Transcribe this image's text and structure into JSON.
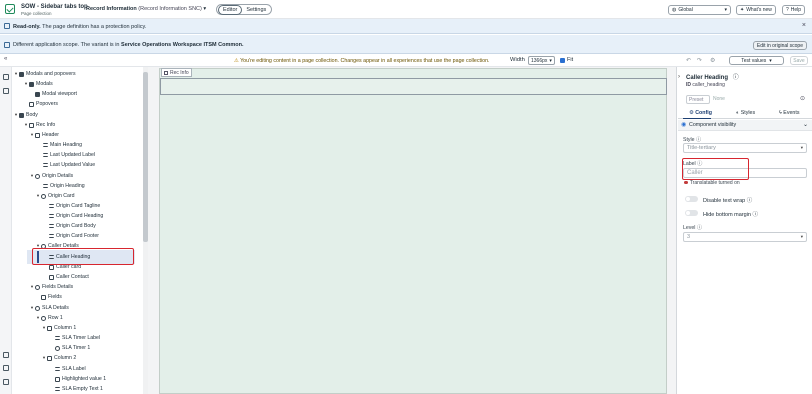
{
  "header": {
    "app_title": "SOW - Sidebar tabs top",
    "app_subtitle": "Page collection",
    "record_title": "Record Information",
    "record_sub": "(Record Information SNC)",
    "mode_editor": "Editor",
    "mode_settings": "Settings",
    "scope": "Global",
    "whats_new": "What's new",
    "help": "Help"
  },
  "banners": {
    "readonly_bold": "Read-only.",
    "readonly_text": "The page definition has a protection policy.",
    "scope_text": "Different application scope. The variant is in",
    "scope_name": "Service Operations Workspace ITSM Common.",
    "edit_scope_button": "Edit in original scope"
  },
  "toolbar": {
    "warning": "You're editing content in a page collection. Changes appear in all experiences that use the page collection.",
    "width_label": "Width",
    "width_value": "1366px",
    "fit_label": "Fit",
    "test_values": "Test values",
    "save": "Save"
  },
  "tree": {
    "items": [
      {
        "label": "Modals and popovers"
      },
      {
        "label": "Modals"
      },
      {
        "label": "Modal viewport"
      },
      {
        "label": "Popovers"
      },
      {
        "label": "Body"
      },
      {
        "label": "Rec Info"
      },
      {
        "label": "Header"
      },
      {
        "label": "Main Heading"
      },
      {
        "label": "Last Updated Label"
      },
      {
        "label": "Last Updated Value"
      },
      {
        "label": "Origin Details"
      },
      {
        "label": "Origin Heading"
      },
      {
        "label": "Origin Card"
      },
      {
        "label": "Origin Card Tagline"
      },
      {
        "label": "Origin Card Heading"
      },
      {
        "label": "Origin Card Body"
      },
      {
        "label": "Origin Card Footer"
      },
      {
        "label": "Caller Details"
      },
      {
        "label": "Caller Heading"
      },
      {
        "label": "Caller card"
      },
      {
        "label": "Caller Contact"
      },
      {
        "label": "Fields Details"
      },
      {
        "label": "Fields"
      },
      {
        "label": "SLA Details"
      },
      {
        "label": "Row 1"
      },
      {
        "label": "Column 1"
      },
      {
        "label": "SLA Timer Label"
      },
      {
        "label": "SLA Timer 1"
      },
      {
        "label": "Column 2"
      },
      {
        "label": "SLA Label"
      },
      {
        "label": "Highlighted value 1"
      },
      {
        "label": "SLA Empty Text 1"
      }
    ]
  },
  "canvas": {
    "tag": "Rec Info"
  },
  "config": {
    "title": "Caller Heading",
    "component_id": "caller_heading",
    "preset_label": "Preset",
    "preset_value": "None",
    "tab_config": "Config",
    "tab_styles": "Styles",
    "tab_events": "Events",
    "component_visibility": "Component visibility",
    "style_label": "Style",
    "style_value": "Title-tertiary",
    "label_label": "Label",
    "label_value": "Caller",
    "translatable": "Translatable turned on",
    "disable_wrap": "Disable text wrap",
    "hide_margin": "Hide bottom margin",
    "level_label": "Level",
    "level_value": "3"
  }
}
